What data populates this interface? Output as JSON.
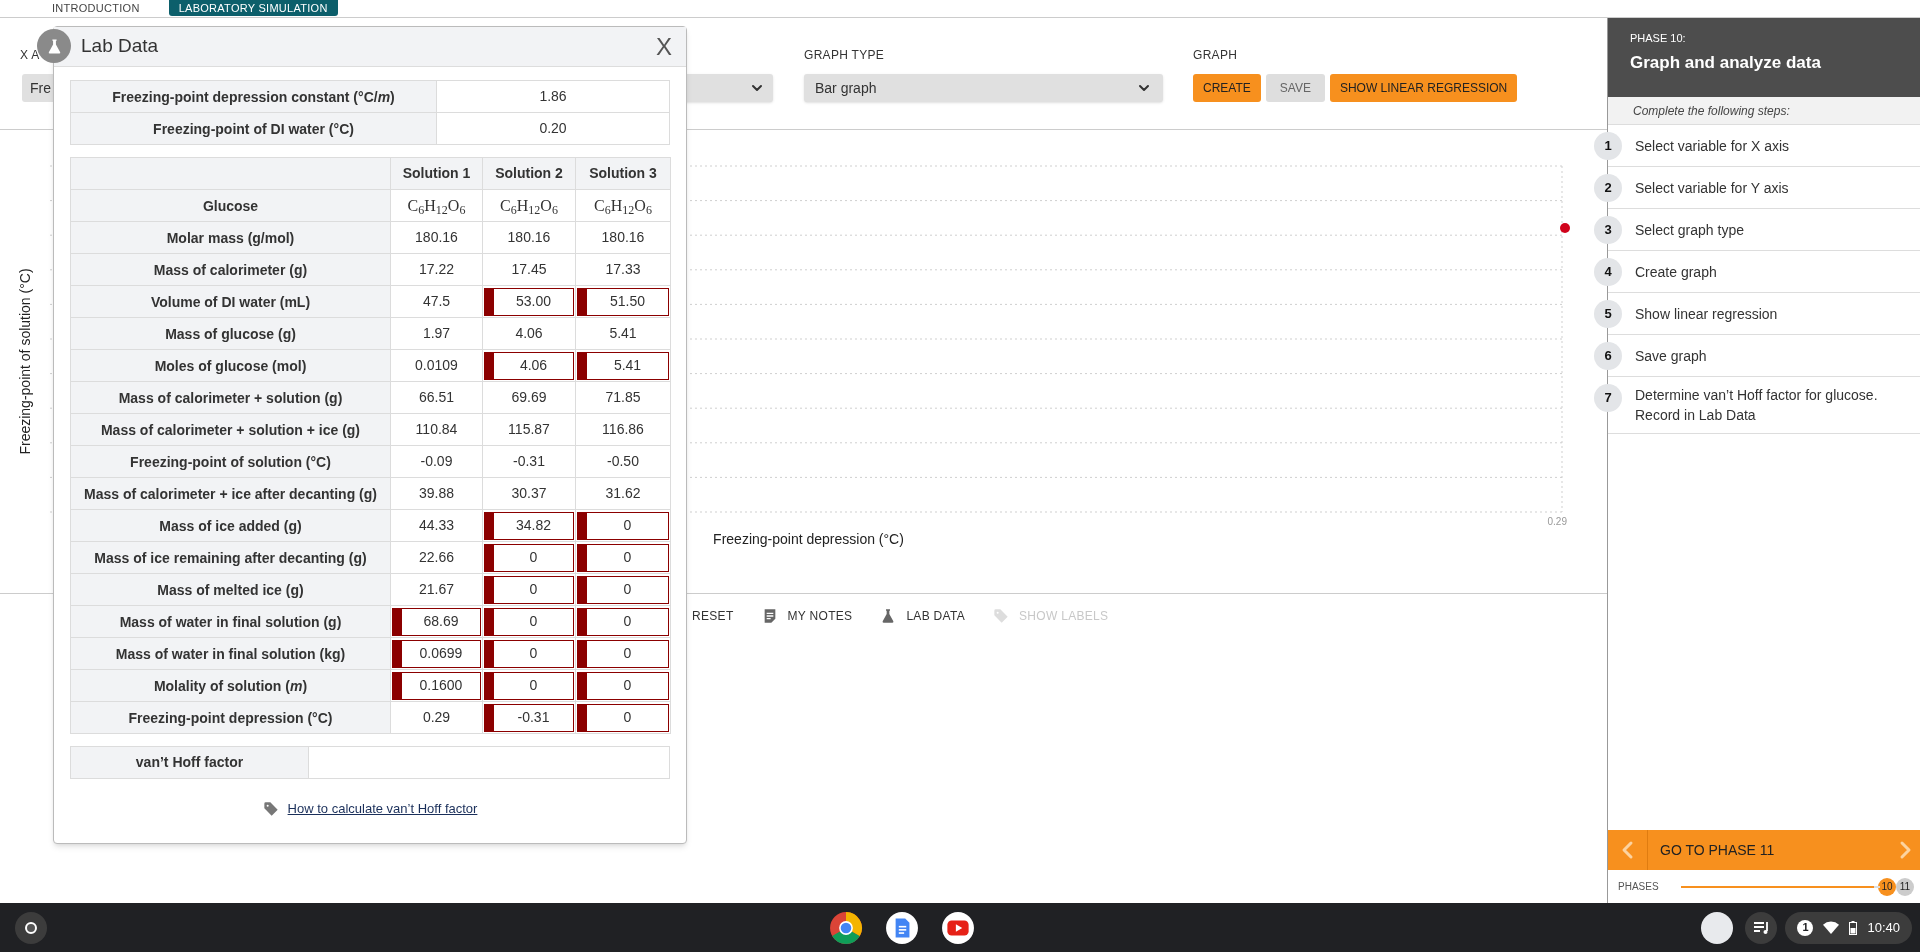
{
  "top_tabs": [
    {
      "label": "INTRODUCTION",
      "selected": false
    },
    {
      "label": "LABORATORY SIMULATION",
      "selected": true
    }
  ],
  "controls": {
    "x_axis": {
      "label": "X A",
      "value": "Fre"
    },
    "graph_type": {
      "label": "GRAPH TYPE",
      "value": "Bar graph"
    },
    "graph": {
      "label": "GRAPH",
      "buttons": [
        {
          "label": "CREATE",
          "enabled": true
        },
        {
          "label": "SAVE",
          "enabled": false
        },
        {
          "label": "SHOW LINEAR REGRESSION",
          "enabled": true
        }
      ]
    }
  },
  "chart": {
    "ylabel": "Freezing-point of solution (°C)",
    "xlabel": "Freezing-point depression (°C)",
    "x_tick": "0.29"
  },
  "toolbar": [
    {
      "label": "RESET",
      "kind": "plain",
      "disabled": false
    },
    {
      "label": "MY NOTES",
      "kind": "notes",
      "disabled": false
    },
    {
      "label": "LAB DATA",
      "kind": "flask",
      "disabled": false
    },
    {
      "label": "SHOW LABELS",
      "kind": "tag",
      "disabled": true
    }
  ],
  "lab_data": {
    "title": "Lab Data",
    "close": "X",
    "constants": [
      {
        "label": "Freezing-point depression constant (°C/*m*)",
        "value": "1.86"
      },
      {
        "label": "Freezing-point of DI water (°C)",
        "value": "0.20"
      }
    ],
    "columns": [
      "Solution 1",
      "Solution 2",
      "Solution 3"
    ],
    "rows": [
      {
        "label": "Glucose",
        "kind": "formula",
        "cells": [
          {
            "value": "C$_{6}$H$_{12}$O$_{6}$",
            "flagged": false
          },
          {
            "value": "C$_{6}$H$_{12}$O$_{6}$",
            "flagged": false
          },
          {
            "value": "C$_{6}$H$_{12}$O$_{6}$",
            "flagged": false
          }
        ]
      },
      {
        "label": "Molar mass (g/mol)",
        "kind": "number",
        "cells": [
          {
            "value": "180.16",
            "flagged": false
          },
          {
            "value": "180.16",
            "flagged": false
          },
          {
            "value": "180.16",
            "flagged": false
          }
        ]
      },
      {
        "label": "Mass of calorimeter (g)",
        "kind": "number",
        "cells": [
          {
            "value": "17.22",
            "flagged": false
          },
          {
            "value": "17.45",
            "flagged": false
          },
          {
            "value": "17.33",
            "flagged": false
          }
        ]
      },
      {
        "label": "Volume of DI water (mL)",
        "kind": "number",
        "cells": [
          {
            "value": "47.5",
            "flagged": false
          },
          {
            "value": "53.00",
            "flagged": true
          },
          {
            "value": "51.50",
            "flagged": true
          }
        ]
      },
      {
        "label": "Mass of glucose (g)",
        "kind": "number",
        "cells": [
          {
            "value": "1.97",
            "flagged": false
          },
          {
            "value": "4.06",
            "flagged": false
          },
          {
            "value": "5.41",
            "flagged": false
          }
        ]
      },
      {
        "label": "Moles of glucose (mol)",
        "kind": "number",
        "cells": [
          {
            "value": "0.0109",
            "flagged": false
          },
          {
            "value": "4.06",
            "flagged": true
          },
          {
            "value": "5.41",
            "flagged": true
          }
        ]
      },
      {
        "label": "Mass of calorimeter + solution (g)",
        "kind": "number",
        "cells": [
          {
            "value": "66.51",
            "flagged": false
          },
          {
            "value": "69.69",
            "flagged": false
          },
          {
            "value": "71.85",
            "flagged": false
          }
        ]
      },
      {
        "label": "Mass of calorimeter + solution + ice (g)",
        "kind": "number",
        "cells": [
          {
            "value": "110.84",
            "flagged": false
          },
          {
            "value": "115.87",
            "flagged": false
          },
          {
            "value": "116.86",
            "flagged": false
          }
        ]
      },
      {
        "label": "Freezing-point of solution (°C)",
        "kind": "number",
        "cells": [
          {
            "value": "-0.09",
            "flagged": false
          },
          {
            "value": "-0.31",
            "flagged": false
          },
          {
            "value": "-0.50",
            "flagged": false
          }
        ]
      },
      {
        "label": "Mass of calorimeter + ice after decanting (g)",
        "kind": "number",
        "cells": [
          {
            "value": "39.88",
            "flagged": false
          },
          {
            "value": "30.37",
            "flagged": false
          },
          {
            "value": "31.62",
            "flagged": false
          }
        ]
      },
      {
        "label": "Mass of ice added (g)",
        "kind": "number",
        "cells": [
          {
            "value": "44.33",
            "flagged": false
          },
          {
            "value": "34.82",
            "flagged": true
          },
          {
            "value": "0",
            "flagged": true
          }
        ]
      },
      {
        "label": "Mass of ice remaining after decanting (g)",
        "kind": "number",
        "cells": [
          {
            "value": "22.66",
            "flagged": false
          },
          {
            "value": "0",
            "flagged": true
          },
          {
            "value": "0",
            "flagged": true
          }
        ]
      },
      {
        "label": "Mass of melted ice (g)",
        "kind": "number",
        "cells": [
          {
            "value": "21.67",
            "flagged": false
          },
          {
            "value": "0",
            "flagged": true
          },
          {
            "value": "0",
            "flagged": true
          }
        ]
      },
      {
        "label": "Mass of water in final solution (g)",
        "kind": "number",
        "cells": [
          {
            "value": "68.69",
            "flagged": true
          },
          {
            "value": "0",
            "flagged": true
          },
          {
            "value": "0",
            "flagged": true
          }
        ]
      },
      {
        "label": "Mass of water in final solution (kg)",
        "kind": "number",
        "cells": [
          {
            "value": "0.0699",
            "flagged": true
          },
          {
            "value": "0",
            "flagged": true
          },
          {
            "value": "0",
            "flagged": true
          }
        ]
      },
      {
        "label": "Molality of solution (*m*)",
        "kind": "number",
        "cells": [
          {
            "value": "0.1600",
            "flagged": true
          },
          {
            "value": "0",
            "flagged": true
          },
          {
            "value": "0",
            "flagged": true
          }
        ]
      },
      {
        "label": "Freezing-point depression (°C)",
        "kind": "number",
        "cells": [
          {
            "value": "0.29",
            "flagged": false
          },
          {
            "value": "-0.31",
            "flagged": true
          },
          {
            "value": "0",
            "flagged": true
          }
        ]
      }
    ],
    "vant_hoff": {
      "label": "van’t Hoff factor"
    },
    "help_link": "How to calculate van’t Hoff factor"
  },
  "phase_panel": {
    "phase": "PHASE 10:",
    "title": "Graph and analyze data",
    "instructions": "Complete the following steps:",
    "steps": [
      {
        "number": "1",
        "text": "Select variable for X axis"
      },
      {
        "number": "2",
        "text": "Select variable for Y axis"
      },
      {
        "number": "3",
        "text": "Select graph type"
      },
      {
        "number": "4",
        "text": "Create graph"
      },
      {
        "number": "5",
        "text": "Show linear regression"
      },
      {
        "number": "6",
        "text": "Save graph"
      },
      {
        "number": "7",
        "text": "Determine van’t Hoff factor for glucose. Record in Lab Data"
      }
    ],
    "next_button": "GO TO PHASE 11",
    "phases": {
      "label": "PHASES",
      "level": 0.97,
      "current": "10",
      "last": "11"
    }
  },
  "taskbar": {
    "notification_count": "1",
    "time": "10:40"
  }
}
